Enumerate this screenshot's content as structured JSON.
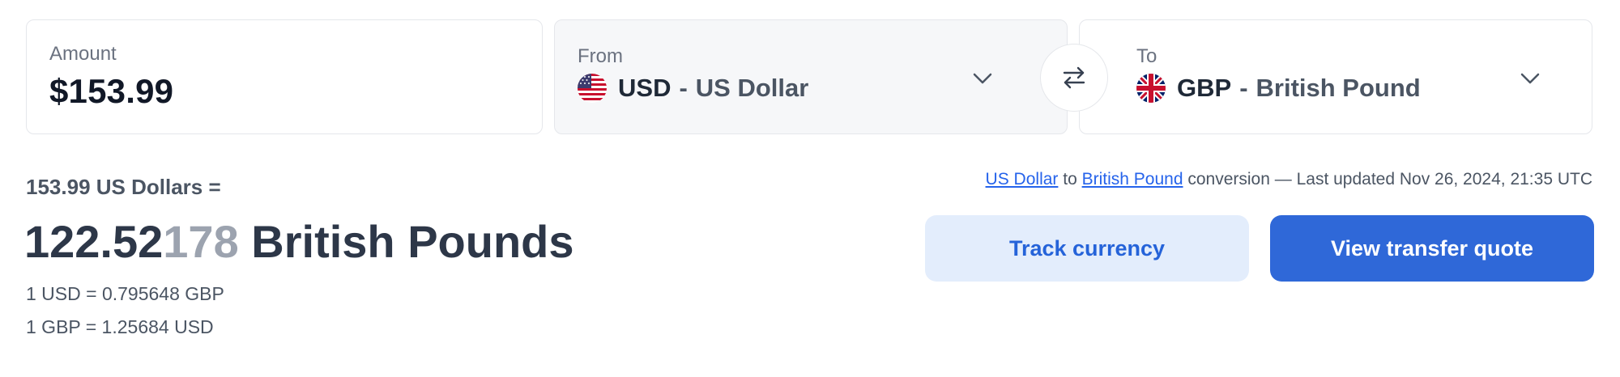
{
  "amount": {
    "label": "Amount",
    "value": "$153.99"
  },
  "from": {
    "label": "From",
    "code": "USD",
    "separator": "-",
    "name": "US Dollar",
    "flag_icon": "us-flag-icon"
  },
  "to": {
    "label": "To",
    "code": "GBP",
    "separator": "-",
    "name": "British Pound",
    "flag_icon": "uk-flag-icon"
  },
  "swap": {
    "icon": "swap-arrows-icon"
  },
  "result": {
    "source_line": "153.99 US Dollars =",
    "value_main": "122.52",
    "value_faded": "178",
    "unit": " British Pounds",
    "rate_1": "1 USD = 0.795648 GBP",
    "rate_2": "1 GBP = 1.25684 USD"
  },
  "meta": {
    "link_from": "US Dollar",
    "to_word": "to",
    "link_to": "British Pound",
    "suffix": "conversion — Last updated Nov 26, 2024, 21:35 UTC"
  },
  "buttons": {
    "track": "Track currency",
    "quote": "View transfer quote"
  },
  "colors": {
    "primary": "#2f68d8",
    "primary_light": "#e3edfc",
    "text_dark": "#1f2937",
    "muted": "#6b7280"
  }
}
